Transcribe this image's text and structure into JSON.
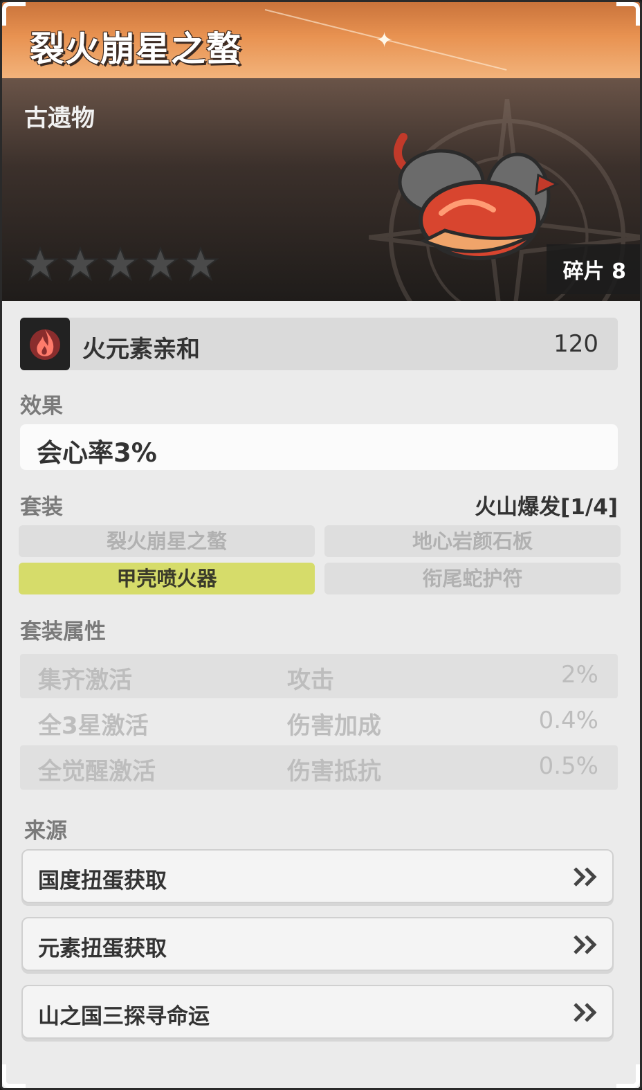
{
  "header": {
    "title": "裂火崩星之螯"
  },
  "hero": {
    "category": "古遗物",
    "stars_filled": 0,
    "stars_total": 5,
    "fragments": "碎片 8"
  },
  "affinity": {
    "label": "火元素亲和",
    "value": "120",
    "icon": "fire-element-icon"
  },
  "effect": {
    "heading": "效果",
    "text": "会心率3%"
  },
  "set": {
    "heading": "套装",
    "name": "火山爆发[1/4]",
    "pieces": [
      {
        "label": "裂火崩星之螯",
        "active": false
      },
      {
        "label": "地心岩颜石板",
        "active": false
      },
      {
        "label": "甲壳喷火器",
        "active": true
      },
      {
        "label": "衔尾蛇护符",
        "active": false
      }
    ]
  },
  "set_attributes": {
    "heading": "套装属性",
    "rows": [
      {
        "condition": "集齐激活",
        "stat": "攻击",
        "value": "2%"
      },
      {
        "condition": "全3星激活",
        "stat": "伤害加成",
        "value": "0.4%"
      },
      {
        "condition": "全觉醒激活",
        "stat": "伤害抵抗",
        "value": "0.5%"
      }
    ]
  },
  "source": {
    "heading": "来源",
    "items": [
      {
        "label": "国度扭蛋获取"
      },
      {
        "label": "元素扭蛋获取"
      },
      {
        "label": "山之国三探寻命运"
      }
    ]
  },
  "colors": {
    "accent_orange": "#e89251",
    "active_set": "#d6dc6a",
    "fire_red": "#d9443a"
  }
}
